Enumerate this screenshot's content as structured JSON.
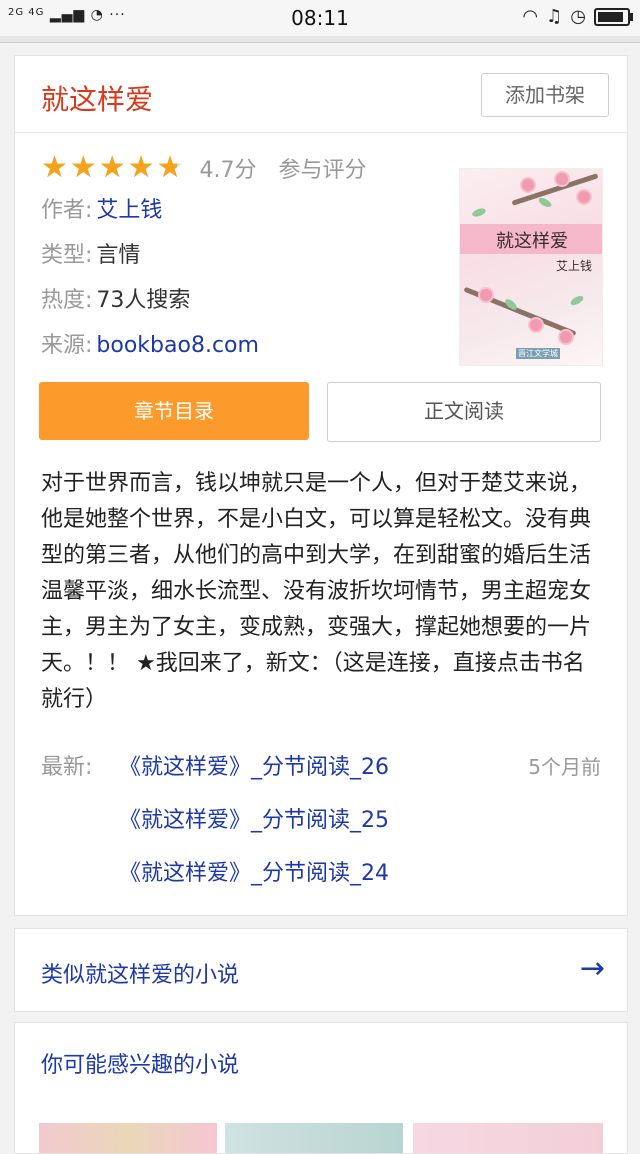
{
  "status_bar": {
    "left": "2G 4G",
    "dots": "···",
    "time": "08:11",
    "battery_level": 0.9
  },
  "book": {
    "title": "就这样爱",
    "add_shelf": "添加书架",
    "rating_value": 4.7,
    "score": "4.7分",
    "rate_link": "参与评分",
    "info": [
      {
        "key": "作者:",
        "value": "艾上钱",
        "link": true
      },
      {
        "key": "类型:",
        "value": "言情",
        "link": false
      },
      {
        "key": "热度:",
        "value": "73人搜索",
        "link": false
      },
      {
        "key": "来源:",
        "value": "bookbao8.com",
        "link": true
      }
    ],
    "cover": {
      "title": "就这样爱",
      "author": "艾上钱",
      "publisher": "晋江文学城"
    },
    "btn_toc": "章节目录",
    "btn_read": "正文阅读",
    "description": "对于世界而言，钱以坤就只是一个人，但对于楚艾来说，他是她整个世界，不是小白文，可以算是轻松文。没有典型的第三者，从他们的高中到大学，在到甜蜜的婚后生活温馨平淡，细水长流型、没有波折坎坷情节，男主超宠女主，男主为了女主，变成熟，变强大，撑起她想要的一片天。！！ ★我回来了，新文：（这是连接，直接点击书名就行）",
    "latest_label": "最新:",
    "latest_time": "5个月前",
    "chapters": [
      "《就这样爱》_分节阅读_26",
      "《就这样爱》_分节阅读_25",
      "《就这样爱》_分节阅读_24"
    ]
  },
  "similar": {
    "label": "类似就这样爱的小说",
    "arrow_icon": "→"
  },
  "interest": {
    "title": "你可能感兴趣的小说"
  },
  "colors": {
    "title_red": "#d9391b",
    "link_blue": "#1d38a8",
    "star_orange": "#f7a21b",
    "button_orange": "#fc9a2c"
  }
}
